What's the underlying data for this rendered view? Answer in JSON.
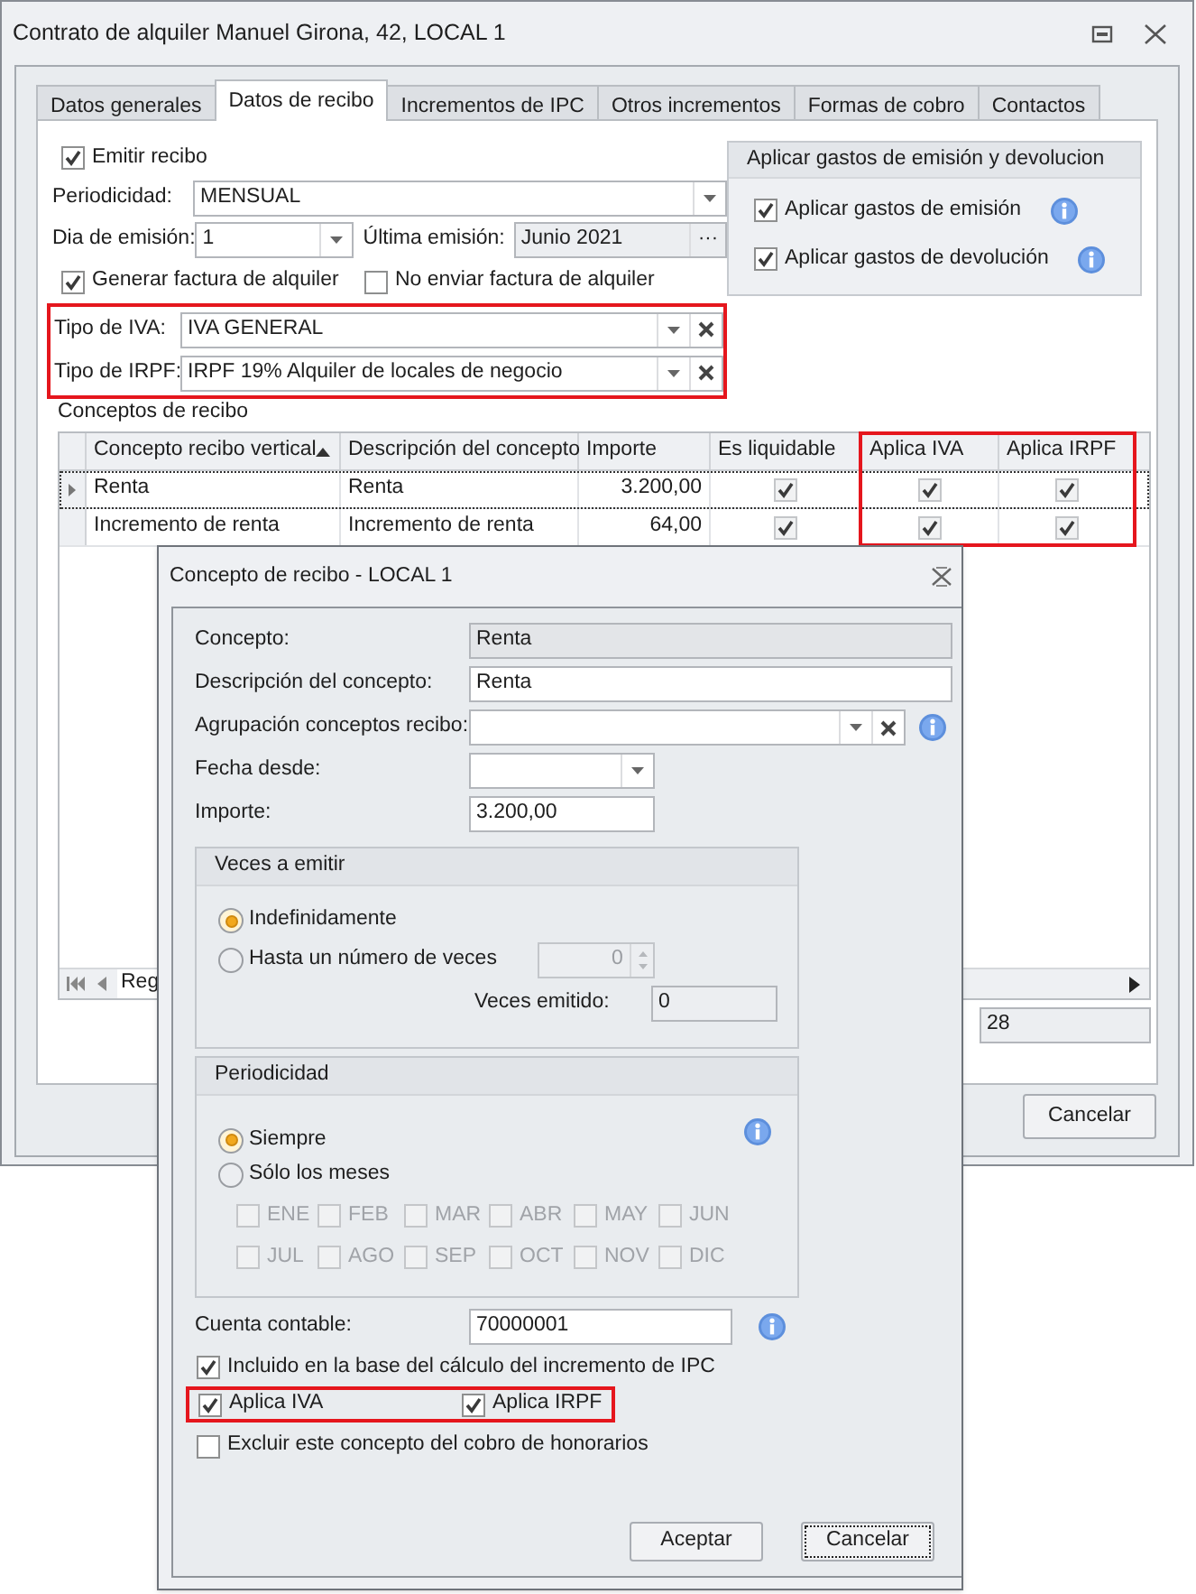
{
  "window": {
    "title": "Contrato de alquiler Manuel Girona, 42, LOCAL 1"
  },
  "tabs": [
    {
      "label": "Datos generales",
      "selected": false
    },
    {
      "label": "Datos de recibo",
      "selected": true
    },
    {
      "label": "Incrementos de IPC",
      "selected": false
    },
    {
      "label": "Otros incrementos",
      "selected": false
    },
    {
      "label": "Formas de cobro",
      "selected": false
    },
    {
      "label": "Contactos",
      "selected": false
    }
  ],
  "receipt": {
    "emit_receipt": {
      "label": "Emitir recibo",
      "checked": true
    },
    "periodicity": {
      "label": "Periodicidad:",
      "value": "MENSUAL"
    },
    "issue_day": {
      "label": "Dia de emisión:",
      "value": "1"
    },
    "last_issue": {
      "label": "Última emisión:",
      "value": "Junio 2021",
      "button": "···"
    },
    "generate_invoice": {
      "label": "Generar factura de alquiler",
      "checked": true
    },
    "no_send_invoice": {
      "label": "No enviar factura de alquiler",
      "checked": false
    },
    "tax_fields_highlighted": true,
    "vat_type": {
      "label": "Tipo de IVA:",
      "value": "IVA GENERAL"
    },
    "irpf_type": {
      "label": "Tipo de IRPF:",
      "value": "IRPF 19% Alquiler de locales de negocio"
    }
  },
  "expenses_group": {
    "title": "Aplicar gastos de emisión y devolucion",
    "options": [
      {
        "label": "Aplicar gastos de emisión",
        "checked": true
      },
      {
        "label": "Aplicar gastos de devolución",
        "checked": true
      }
    ]
  },
  "concepts": {
    "title": "Conceptos de recibo",
    "columns": [
      {
        "label": "Concepto recibo vertical",
        "sorted": true,
        "highlighted": false
      },
      {
        "label": "Descripción del concepto",
        "sorted": false,
        "highlighted": false
      },
      {
        "label": "Importe",
        "sorted": false,
        "highlighted": false
      },
      {
        "label": "Es liquidable",
        "sorted": false,
        "highlighted": false
      },
      {
        "label": "Aplica IVA",
        "sorted": false,
        "highlighted": true
      },
      {
        "label": "Aplica IRPF",
        "sorted": false,
        "highlighted": true
      }
    ],
    "rows": [
      {
        "selected": true,
        "concept": "Renta",
        "description": "Renta",
        "amount": "3.200,00",
        "liquidable": true,
        "vat": true,
        "irpf": true
      },
      {
        "selected": false,
        "concept": "Incremento de renta",
        "description": "Incremento de renta",
        "amount": "64,00",
        "liquidable": true,
        "vat": true,
        "irpf": true
      }
    ],
    "navigator_text": "Reg"
  },
  "partial_field": {
    "value": "28"
  },
  "buttons": [
    {
      "label": "Cancelar"
    }
  ],
  "dialog": {
    "title": "Concepto de recibo - LOCAL 1",
    "concept": {
      "label": "Concepto:",
      "value": "Renta"
    },
    "description": {
      "label": "Descripción del concepto:",
      "value": "Renta"
    },
    "grouping": {
      "label": "Agrupación conceptos recibo:"
    },
    "date_from": {
      "label": "Fecha desde:"
    },
    "amount": {
      "label": "Importe:",
      "value": "3.200,00"
    },
    "times_group": {
      "title": "Veces a emitir",
      "options": [
        {
          "label": "Indefinidamente",
          "selected": true
        },
        {
          "label": "Hasta un número de veces",
          "selected": false
        }
      ],
      "count": {
        "value": "0",
        "disabled": true
      },
      "issued": {
        "label": "Veces emitido:",
        "value": "0"
      }
    },
    "periodicity_group": {
      "title": "Periodicidad",
      "options": [
        {
          "label": "Siempre",
          "selected": true
        },
        {
          "label": "Sólo los meses",
          "selected": false
        }
      ],
      "months_disabled": true,
      "months": [
        {
          "label": "ENE",
          "checked": false
        },
        {
          "label": "FEB",
          "checked": false
        },
        {
          "label": "MAR",
          "checked": false
        },
        {
          "label": "ABR",
          "checked": false
        },
        {
          "label": "MAY",
          "checked": false
        },
        {
          "label": "JUN",
          "checked": false
        },
        {
          "label": "JUL",
          "checked": false
        },
        {
          "label": "AGO",
          "checked": false
        },
        {
          "label": "SEP",
          "checked": false
        },
        {
          "label": "OCT",
          "checked": false
        },
        {
          "label": "NOV",
          "checked": false
        },
        {
          "label": "DIC",
          "checked": false
        }
      ]
    },
    "account": {
      "label": "Cuenta contable:",
      "value": "70000001"
    },
    "include_ipc": {
      "label": "Incluido en la base del cálculo del incremento de IPC",
      "checked": true
    },
    "taxes_highlighted": true,
    "apply_vat": {
      "label": "Aplica IVA",
      "checked": true
    },
    "apply_irpf": {
      "label": "Aplica IRPF",
      "checked": true
    },
    "exclude_fees": {
      "label": "Excluir este concepto del cobro de honorarios",
      "checked": false
    },
    "buttons": [
      {
        "label": "Aceptar",
        "focused": false
      },
      {
        "label": "Cancelar",
        "focused": true
      }
    ]
  }
}
